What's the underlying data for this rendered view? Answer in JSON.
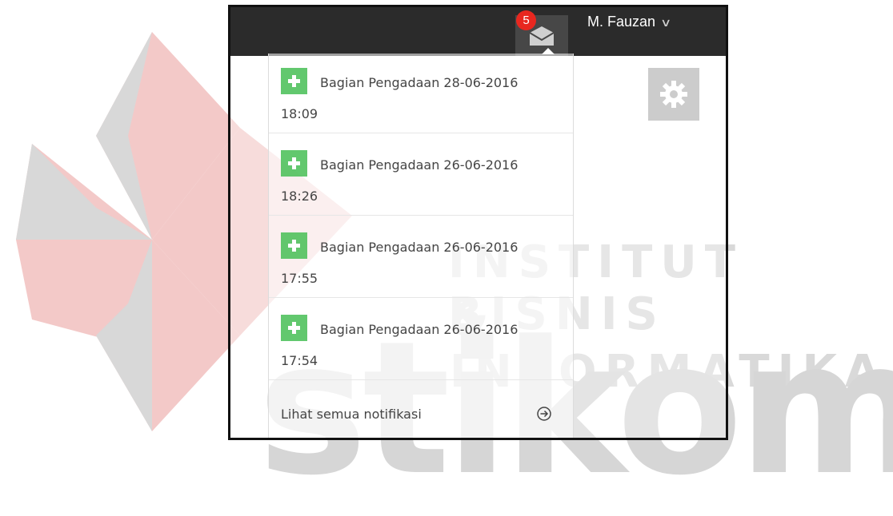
{
  "watermark": {
    "line1": "INSTITUT BISNIS",
    "line2": "& INFORMATIKA",
    "brand": "stikom"
  },
  "header": {
    "notification_count": "5",
    "user_name": "M. Fauzan",
    "user_caret": "∨"
  },
  "icons": {
    "mail": "envelope-icon",
    "gear": "gear-icon",
    "plus": "plus-icon",
    "arrow": "arrow-circle-right-icon"
  },
  "colors": {
    "topbar": "#2b2b2b",
    "badge": "#e8271f",
    "plus_bg": "#46be55",
    "gear_bg": "#cccccc"
  },
  "notifications": [
    {
      "title": "Bagian Pengadaan 28-06-2016",
      "time": "18:09"
    },
    {
      "title": "Bagian Pengadaan 26-06-2016",
      "time": "18:26"
    },
    {
      "title": "Bagian Pengadaan 26-06-2016",
      "time": "17:55"
    },
    {
      "title": "Bagian Pengadaan 26-06-2016",
      "time": "17:54"
    }
  ],
  "footer": {
    "see_all_label": "Lihat semua notifikasi"
  }
}
